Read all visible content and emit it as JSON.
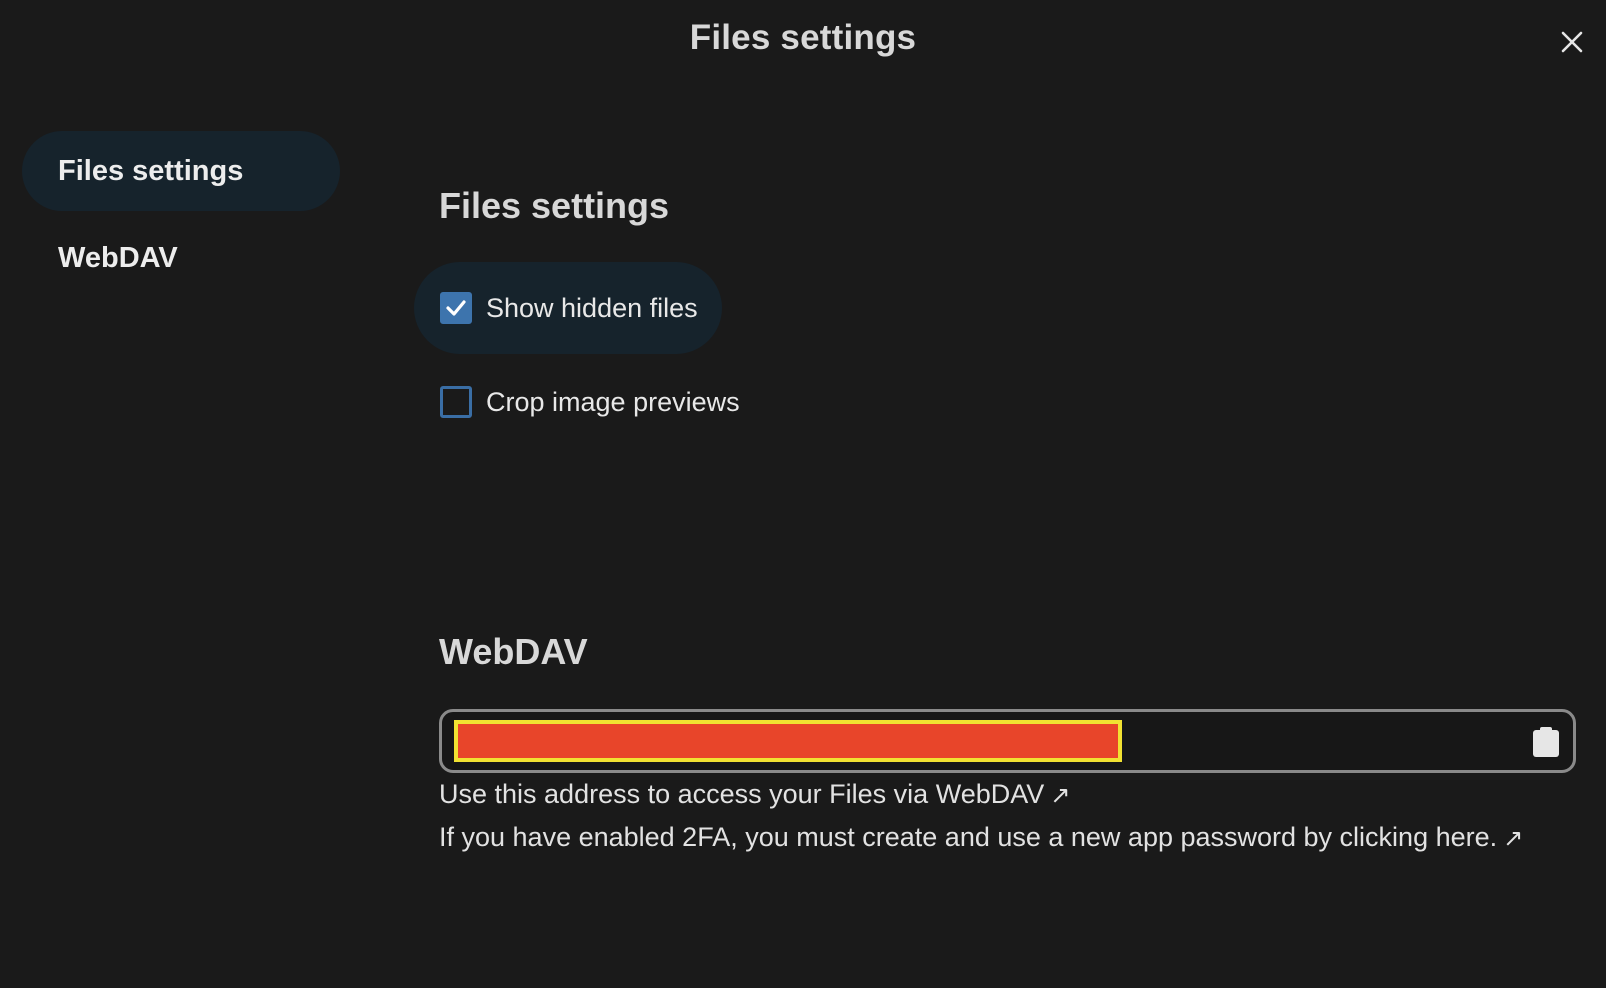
{
  "dialog": {
    "title": "Files settings"
  },
  "sidebar": {
    "items": [
      {
        "label": "Files settings",
        "active": true
      },
      {
        "label": "WebDAV",
        "active": false
      }
    ]
  },
  "files_settings": {
    "heading": "Files settings",
    "options": [
      {
        "label": "Show hidden files",
        "checked": true
      },
      {
        "label": "Crop image previews",
        "checked": false
      }
    ]
  },
  "webdav": {
    "heading": "WebDAV",
    "url_value": "",
    "redacted": true,
    "hint_access": "Use this address to access your Files via WebDAV",
    "hint_2fa": "If you have enabled 2FA, you must create and use a new app password by clicking here.",
    "external_link_icon": "↗"
  },
  "colors": {
    "background": "#1a1a1a",
    "accent": "#3d74ad",
    "highlight": "#16232c",
    "redaction_fill": "#e8452a",
    "redaction_border": "#f1e232"
  },
  "icons": {
    "close": "close-icon",
    "checkmark": "checkmark-icon",
    "clipboard": "clipboard-icon",
    "external_link": "external-link-icon"
  }
}
